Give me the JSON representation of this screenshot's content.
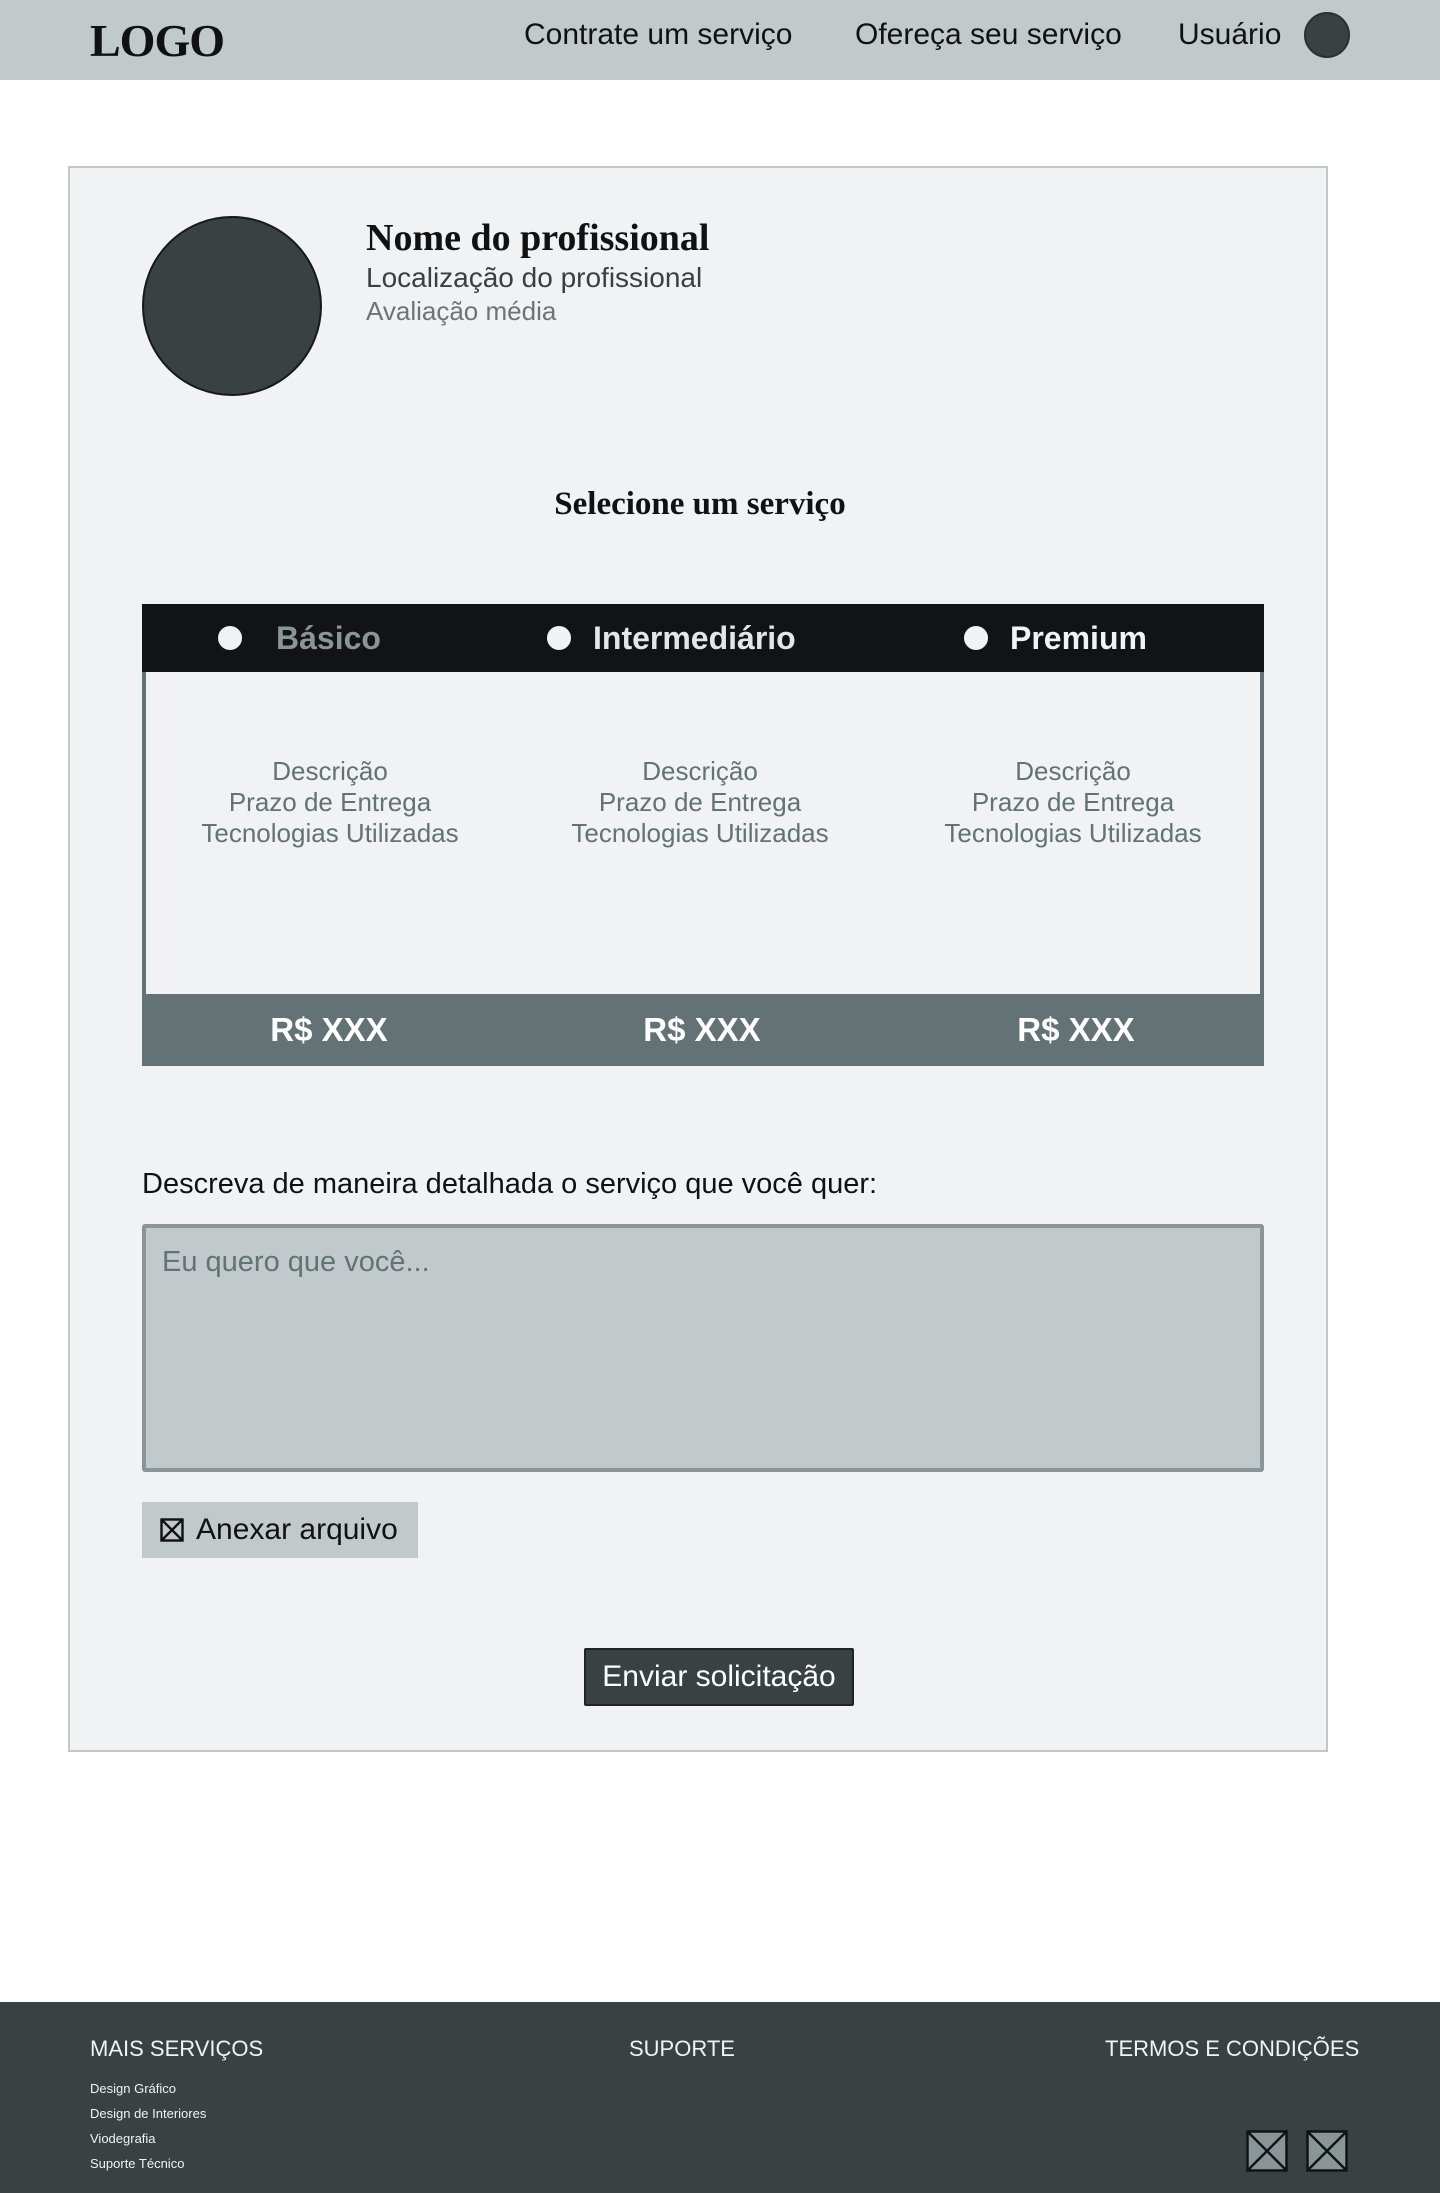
{
  "header": {
    "logo": "LOGO",
    "nav": [
      "Contrate um serviço",
      "Ofereça seu serviço",
      "Usuário"
    ]
  },
  "profile": {
    "name": "Nome do profissional",
    "location": "Localização do profissional",
    "rating": "Avaliação média"
  },
  "service": {
    "title": "Selecione um serviço",
    "plans": [
      {
        "label": "Básico",
        "selected": true,
        "lines": [
          "Descrição",
          "Prazo de Entrega",
          "Tecnologias Utilizadas"
        ],
        "price": "R$ XXX"
      },
      {
        "label": "Intermediário",
        "selected": false,
        "lines": [
          "Descrição",
          "Prazo de Entrega",
          "Tecnologias Utilizadas"
        ],
        "price": "R$ XXX"
      },
      {
        "label": "Premium",
        "selected": false,
        "lines": [
          "Descrição",
          "Prazo de Entrega",
          "Tecnologias Utilizadas"
        ],
        "price": "R$ XXX"
      }
    ]
  },
  "request": {
    "label": "Descreva de maneira detalhada o serviço que você quer:",
    "placeholder": "Eu quero que você...",
    "value": "",
    "attach_label": "Anexar arquivo",
    "attach_icon": "broken-image-icon",
    "submit_label": "Enviar solicitação"
  },
  "footer": {
    "more_services": {
      "title": "MAIS SERVIÇOS",
      "items": [
        "Design Gráfico",
        "Design de Interiores",
        "Viodegrafia",
        "Suporte Técnico"
      ]
    },
    "support": "SUPORTE",
    "terms": "TERMOS E CONDIÇÕES",
    "social_icons": [
      "social-icon-placeholder",
      "social-icon-placeholder"
    ]
  },
  "colors": {
    "header_bg": "#c1c9cb",
    "card_bg": "#f1f2f4",
    "dark": "#394143",
    "plans_header_bg": "#121314",
    "accent_slate": "#627275",
    "footer_bg": "#394143"
  }
}
